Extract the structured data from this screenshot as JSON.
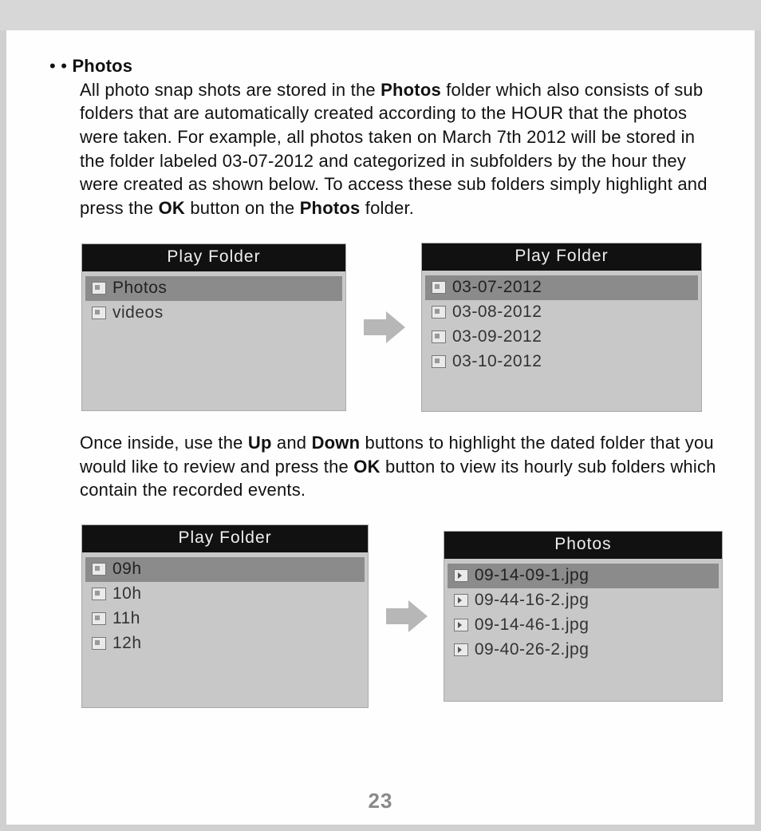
{
  "text": {
    "bullet_prefix": "• • ",
    "heading": "Photos",
    "p1a": "All photo snap shots are stored in the ",
    "p1_bold1": "Photos",
    "p1b": " folder which also consists of sub folders that are automatically created according to the HOUR that the photos were taken. For example, all photos taken on March 7th 2012 will be stored in the folder labeled 03-07-2012 and categorized in subfolders by the hour they were created as shown below. To access these sub folders simply highlight and press the ",
    "p1_bold2": "OK",
    "p1c": " button on the ",
    "p1_bold3": "Photos",
    "p1d": " folder.",
    "p2a": "Once inside, use the ",
    "p2_bold1": "Up",
    "p2b": " and ",
    "p2_bold2": "Down",
    "p2c": " buttons to highlight the dated folder that you would like to review and press the ",
    "p2_bold3": "OK",
    "p2d": " button to view its hourly sub folders which contain the recorded events."
  },
  "panels": {
    "a": {
      "title": "Play Folder",
      "items": [
        "Photos",
        "videos"
      ]
    },
    "b": {
      "title": "Play Folder",
      "items": [
        "03-07-2012",
        "03-08-2012",
        "03-09-2012",
        "03-10-2012"
      ]
    },
    "c": {
      "title": "Play Folder",
      "items": [
        "09h",
        "10h",
        "11h",
        "12h"
      ]
    },
    "d": {
      "title": "Photos",
      "items": [
        "09-14-09-1.jpg",
        "09-44-16-2.jpg",
        "09-14-46-1.jpg",
        "09-40-26-2.jpg"
      ]
    }
  },
  "page_number": "23"
}
